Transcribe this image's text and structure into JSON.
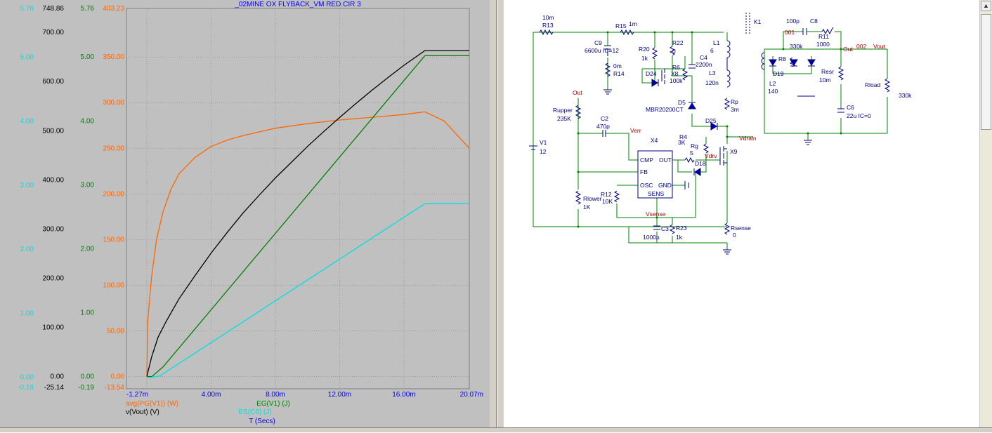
{
  "plot": {
    "title": "_02MINE OX FLYBACK_VM RED.CIR 3",
    "x_axis": {
      "unit_label": "T (Secs)",
      "ticks": [
        "-1.27m",
        "4.00m",
        "8.00m",
        "12.00m",
        "16.00m",
        "20.07m"
      ]
    },
    "y_axes": [
      {
        "name": "ES(C6)",
        "color": "#00e0e0",
        "top": "5.76",
        "bottom": "-0.18",
        "ticks": [
          "5.00",
          "4.00",
          "3.00",
          "2.00",
          "1.00",
          "0.00"
        ]
      },
      {
        "name": "v(Vout)",
        "color": "#000000",
        "top": "748.86",
        "bottom": "-25.14",
        "ticks": [
          "700.00",
          "600.00",
          "500.00",
          "400.00",
          "300.00",
          "200.00",
          "100.00",
          "0.00"
        ]
      },
      {
        "name": "EG(V1)",
        "color": "#008000",
        "top": "5.76",
        "bottom": "-0.19",
        "ticks": [
          "5.00",
          "4.00",
          "3.00",
          "2.00",
          "1.00",
          "0.00"
        ]
      },
      {
        "name": "avg(PG(V1))",
        "color": "#ff6600",
        "top": "403.23",
        "bottom": "-13.54",
        "ticks": [
          "350.00",
          "300.00",
          "250.00",
          "200.00",
          "150.00",
          "100.00",
          "50.00",
          "0.00"
        ]
      }
    ],
    "legend": [
      {
        "label": "avg(PG(V1)) (W)",
        "color": "#ff6600"
      },
      {
        "label": "v(Vout) (V)",
        "color": "#000000"
      },
      {
        "label": "EG(V1) (J)",
        "color": "#008000"
      },
      {
        "label": "ES(C6) (J)",
        "color": "#00e0e0"
      }
    ]
  },
  "chart_data": {
    "type": "line",
    "title": "_02MINE OX FLYBACK_VM RED.CIR 3",
    "xlabel": "T (Secs)",
    "x_unit": "ms",
    "xlim": [
      -1.27,
      20.07
    ],
    "grid": true,
    "series": [
      {
        "name": "avg(PG(V1)) (W)",
        "color": "#ff6600",
        "ylim": [
          -13.54,
          403.23
        ],
        "x": [
          0,
          0.05,
          0.3,
          0.6,
          1.0,
          1.5,
          2.0,
          3.0,
          4.0,
          5.0,
          6.0,
          8.0,
          10.0,
          12.0,
          14.0,
          16.0,
          17.3,
          18.5,
          20.07
        ],
        "y": [
          0,
          60,
          110,
          150,
          180,
          205,
          222,
          240,
          252,
          259,
          264,
          272,
          277,
          281,
          284,
          287,
          290,
          280,
          250
        ]
      },
      {
        "name": "v(Vout) (V)",
        "color": "#000000",
        "ylim": [
          -25.14,
          748.86
        ],
        "x": [
          0,
          0.3,
          0.7,
          1.2,
          2.0,
          3.0,
          4.0,
          5.0,
          6.0,
          7.0,
          8.0,
          9.0,
          10.0,
          11.0,
          12.0,
          13.0,
          14.0,
          15.0,
          16.0,
          17.0,
          17.3,
          18.0,
          19.0,
          20.07
        ],
        "y": [
          0,
          40,
          80,
          112,
          158,
          205,
          251,
          293,
          333,
          369,
          404,
          436,
          468,
          498,
          527,
          555,
          582,
          608,
          633,
          656,
          663,
          663,
          663,
          663
        ]
      },
      {
        "name": "EG(V1) (J)",
        "color": "#008000",
        "ylim": [
          -0.19,
          5.76
        ],
        "x": [
          0,
          0.3,
          1.0,
          17.3,
          18.0,
          19.0,
          20.07
        ],
        "y": [
          0,
          0.0,
          0.15,
          5.02,
          5.02,
          5.02,
          5.02
        ]
      },
      {
        "name": "ES(C6) (J)",
        "color": "#00e0e0",
        "ylim": [
          -0.18,
          5.76
        ],
        "x": [
          0,
          0.3,
          0.8,
          17.3,
          18.0,
          19.0,
          20.07
        ],
        "y": [
          0,
          0.0,
          0.02,
          2.71,
          2.71,
          2.71,
          2.71
        ]
      }
    ]
  },
  "schematic": {
    "labels": {
      "r13": "R13",
      "r13v": "10m",
      "r15": "R15",
      "r15v": "1m",
      "c9": "C9",
      "c9v": "6600u IC=12",
      "r14": "R14",
      "r14v": "0m",
      "r20": "R20",
      "r20v": "1k",
      "r22": "R22",
      "r22v": "0",
      "d24": "D24",
      "r6": "R6",
      "x8": "X8",
      "r6v": "100k",
      "c4": "C4",
      "c4v": "2200n",
      "l1": "L1",
      "l1v": "6",
      "l3": "L3",
      "l3v": "120n",
      "k1": "K1",
      "d5": "D5",
      "d5v": "MBR20200CT",
      "rp": "Rp",
      "rpv": "3m",
      "d25": "D25",
      "out1": "Out",
      "rupper": "Rupper",
      "rupperv": "235K",
      "c2": "C2",
      "c2v": "470p",
      "verr": "Verr",
      "x4": "X4",
      "cmp": "CMP",
      "outpin": "OUT",
      "fb": "FB",
      "osc": "OSC",
      "gnd": "GND",
      "sens": "SENS",
      "r4": "R4",
      "r4v": "3K",
      "rg": "Rg",
      "rgv": "5",
      "d18": "D18",
      "vdrv": "Vdrv",
      "vdrain": "Vdrain",
      "x9": "X9",
      "v1": "V1",
      "v1v": "12",
      "r12": "R12",
      "r12v": "10K",
      "rlower": "Rlower",
      "rlowerv": "1K",
      "vsense": "Vsense",
      "c3": "C3",
      "c3v": "1000p",
      "r23": "R23",
      "r23v": "1k",
      "rsense": "Rsense",
      "rsensev": "0",
      "c8": "C8",
      "c8v": "100p",
      "n001": "001",
      "r11": "R11",
      "r11v": "1000",
      "r8": "R8",
      "r8v": "330k",
      "d19": "D19",
      "l2": "L2",
      "l2v": "140",
      "out2": "Out",
      "n002": "002",
      "vout": "Vout",
      "resr": "Resr",
      "resrv": "10m",
      "rload": "Rload",
      "rloadv": "330k",
      "c6": "C6",
      "c6v": "22u IC=0"
    }
  }
}
